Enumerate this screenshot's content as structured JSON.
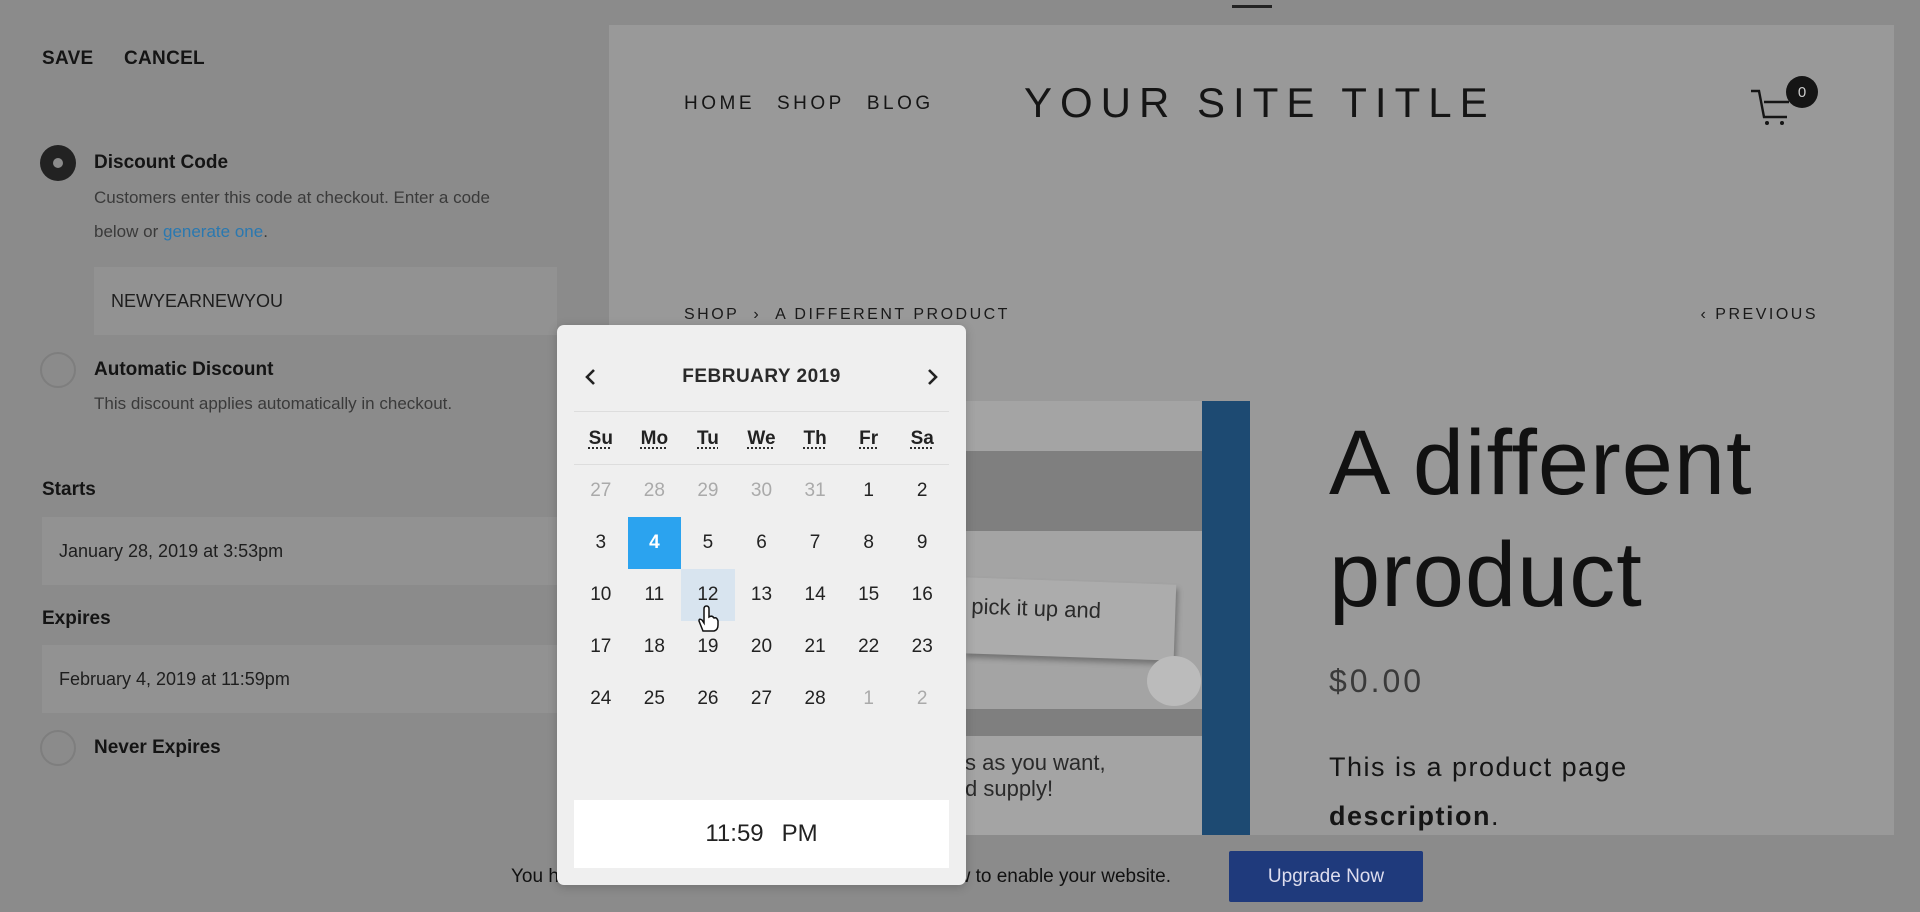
{
  "toolbar": {
    "save": "SAVE",
    "cancel": "CANCEL"
  },
  "form": {
    "discount_code": {
      "label": "Discount Code",
      "desc_line1": "Customers enter this code at checkout. Enter a code",
      "desc_line2_prefix": "below or ",
      "generate_link": "generate one",
      "desc_suffix": ".",
      "value": "NEWYEARNEWYOU",
      "selected": true
    },
    "automatic": {
      "label": "Automatic Discount",
      "desc": "This discount applies automatically in checkout.",
      "selected": false
    },
    "starts": {
      "label": "Starts",
      "value": "January 28, 2019 at 3:53pm"
    },
    "expires": {
      "label": "Expires",
      "value": "February 4, 2019 at 11:59pm"
    },
    "never_expires": {
      "label": "Never Expires",
      "selected": false
    }
  },
  "preview": {
    "nav": [
      "HOME",
      "SHOP",
      "BLOG"
    ],
    "site_title": "YOUR SITE TITLE",
    "cart_count": "0",
    "breadcrumb": {
      "shop": "SHOP",
      "sep": "›",
      "current": "A DIFFERENT PRODUCT"
    },
    "previous": "‹ PREVIOUS",
    "product_title_line1": "A different",
    "product_title_line2": "product",
    "price": "$0.00",
    "description_text": "This is a product page",
    "description_bold": "description",
    "description_end": ".",
    "image_text1": "pick it up and",
    "image_text2": "s as you want,",
    "image_text3": "d supply!",
    "accent_color": "#1d4a72"
  },
  "calendar": {
    "month": "FEBRUARY 2019",
    "prev_icon": "chevron-left-icon",
    "next_icon": "chevron-right-icon",
    "weekdays": [
      "Su",
      "Mo",
      "Tu",
      "We",
      "Th",
      "Fr",
      "Sa"
    ],
    "weeks": [
      [
        {
          "d": "27",
          "m": true
        },
        {
          "d": "28",
          "m": true
        },
        {
          "d": "29",
          "m": true
        },
        {
          "d": "30",
          "m": true
        },
        {
          "d": "31",
          "m": true
        },
        {
          "d": "1"
        },
        {
          "d": "2"
        }
      ],
      [
        {
          "d": "3"
        },
        {
          "d": "4",
          "sel": true
        },
        {
          "d": "5"
        },
        {
          "d": "6"
        },
        {
          "d": "7"
        },
        {
          "d": "8"
        },
        {
          "d": "9"
        }
      ],
      [
        {
          "d": "10"
        },
        {
          "d": "11"
        },
        {
          "d": "12",
          "hover": true
        },
        {
          "d": "13"
        },
        {
          "d": "14"
        },
        {
          "d": "15"
        },
        {
          "d": "16"
        }
      ],
      [
        {
          "d": "17"
        },
        {
          "d": "18"
        },
        {
          "d": "19"
        },
        {
          "d": "20"
        },
        {
          "d": "21"
        },
        {
          "d": "22"
        },
        {
          "d": "23"
        }
      ],
      [
        {
          "d": "24"
        },
        {
          "d": "25"
        },
        {
          "d": "26"
        },
        {
          "d": "27"
        },
        {
          "d": "28"
        },
        {
          "d": "1",
          "m": true
        },
        {
          "d": "2",
          "m": true
        }
      ]
    ],
    "time": "11:59",
    "ampm": "PM",
    "selected_color": "#2ba3ef"
  },
  "banner": {
    "text_left": "You h",
    "text_right": "ow to enable your website.",
    "upgrade": "Upgrade Now",
    "button_color": "#1f3a7c"
  }
}
